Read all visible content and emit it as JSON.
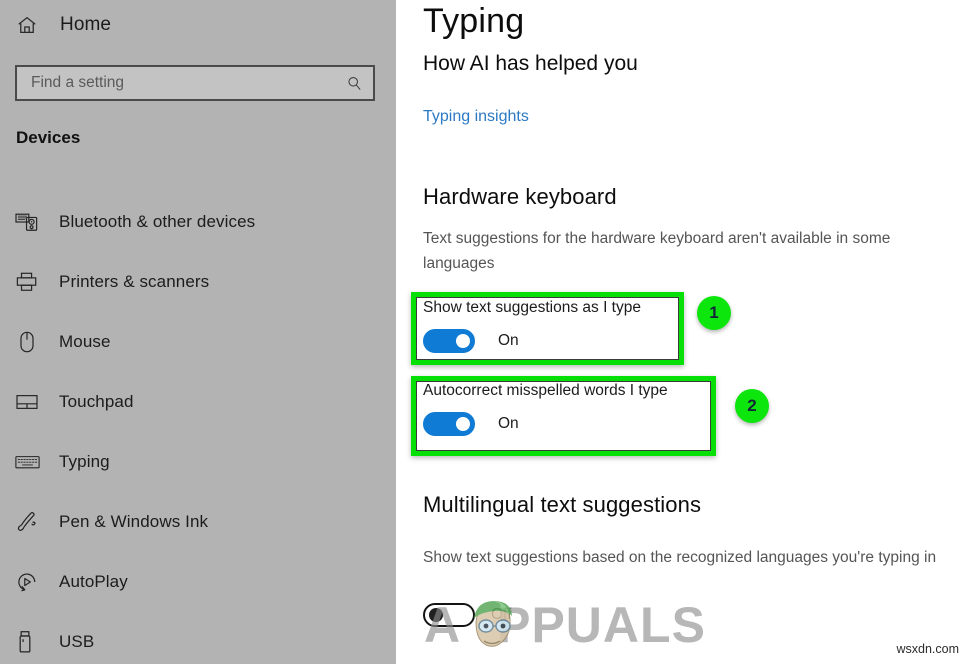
{
  "sidebar": {
    "home": {
      "label": "Home",
      "icon": "home-icon"
    },
    "search": {
      "placeholder": "Find a setting",
      "value": "",
      "icon": "search-icon"
    },
    "section_title": "Devices",
    "items": [
      {
        "label": "Bluetooth & other devices",
        "icon": "bluetooth-devices-icon"
      },
      {
        "label": "Printers & scanners",
        "icon": "printer-icon"
      },
      {
        "label": "Mouse",
        "icon": "mouse-icon"
      },
      {
        "label": "Touchpad",
        "icon": "touchpad-icon"
      },
      {
        "label": "Typing",
        "icon": "keyboard-icon"
      },
      {
        "label": "Pen & Windows Ink",
        "icon": "pen-icon"
      },
      {
        "label": "AutoPlay",
        "icon": "autoplay-icon"
      },
      {
        "label": "USB",
        "icon": "usb-icon"
      }
    ]
  },
  "main": {
    "page_title": "Typing",
    "subtitle": "How AI has helped you",
    "insights_link": "Typing insights",
    "hardware_keyboard": {
      "heading": "Hardware keyboard",
      "description": "Text suggestions for the hardware keyboard aren't available in some languages",
      "settings": [
        {
          "label": "Show text suggestions as I type",
          "state": "On",
          "on": true,
          "badge": "1"
        },
        {
          "label": "Autocorrect misspelled words I type",
          "state": "On",
          "on": true,
          "badge": "2"
        }
      ]
    },
    "multilingual": {
      "heading": "Multilingual text suggestions",
      "description": "Show text suggestions based on the recognized languages you're typing in",
      "setting": {
        "label": "",
        "state": "Off",
        "on": false
      }
    }
  },
  "watermarks": {
    "brand": "PPUALS",
    "brand_lead": "A",
    "source": "wsxdn.com"
  },
  "colors": {
    "sidebar_bg": "#b3b3b3",
    "accent_blue": "#0f7bd4",
    "link_blue": "#2c7ac4",
    "highlight_green": "#06e006",
    "badge_green": "#0ce60c",
    "badge_text": "#16243a"
  }
}
